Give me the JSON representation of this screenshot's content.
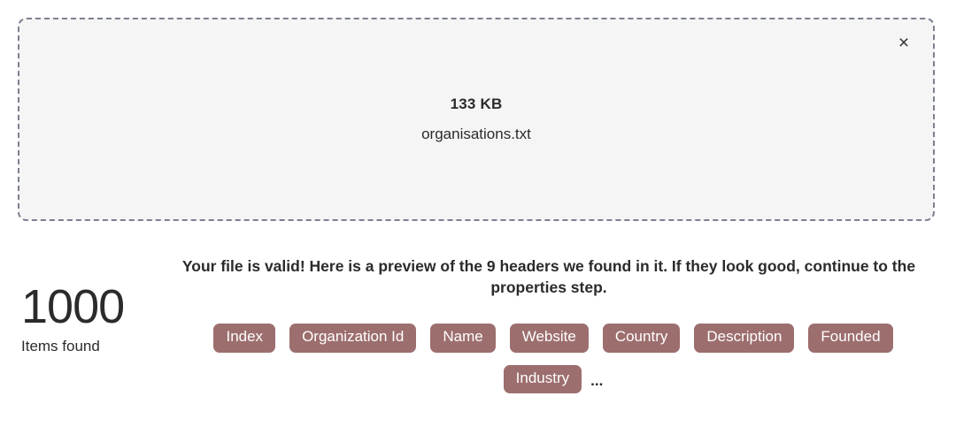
{
  "dropzone": {
    "close_icon": "close-icon",
    "close_glyph": "×",
    "file_size": "133 KB",
    "file_name": "organisations.txt",
    "border_color": "#7b8190",
    "background_color": "#f5f5f6"
  },
  "preview": {
    "headline": "Your file is valid! Here is a preview of the 9 headers we found in it. If they look good, continue to the properties step.",
    "count": "1000",
    "count_label": "Items found",
    "chip_color": "#9d6e6e",
    "chip_text_color": "#ffffff",
    "overflow_indicator": "...",
    "headers": [
      "Index",
      "Organization Id",
      "Name",
      "Website",
      "Country",
      "Description",
      "Founded",
      "Industry"
    ]
  }
}
